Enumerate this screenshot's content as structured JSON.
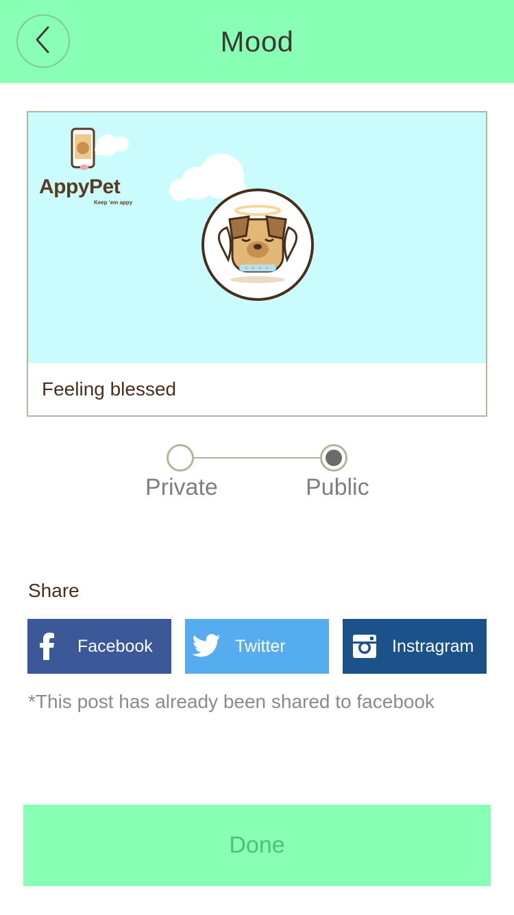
{
  "header": {
    "title": "Mood",
    "back_icon": "chevron-left-icon"
  },
  "card": {
    "caption": "Feeling blessed",
    "brand": {
      "name": "AppyPet",
      "tagline": "Keep 'em appy"
    },
    "bg_color": "#cafcfd"
  },
  "visibility": {
    "options": [
      "Private",
      "Public"
    ],
    "selected": "Public"
  },
  "share": {
    "title": "Share",
    "buttons": [
      {
        "label": "Facebook",
        "icon": "facebook-icon",
        "color": "#3b5998"
      },
      {
        "label": "Twitter",
        "icon": "twitter-icon",
        "color": "#55acee"
      },
      {
        "label": "Instragram",
        "icon": "instagram-icon",
        "color": "#1b5289"
      }
    ],
    "note": "*This post has already been shared to facebook"
  },
  "footer": {
    "done_label": "Done"
  },
  "colors": {
    "accent": "#89ffb6",
    "done_text": "#4ec46f"
  }
}
